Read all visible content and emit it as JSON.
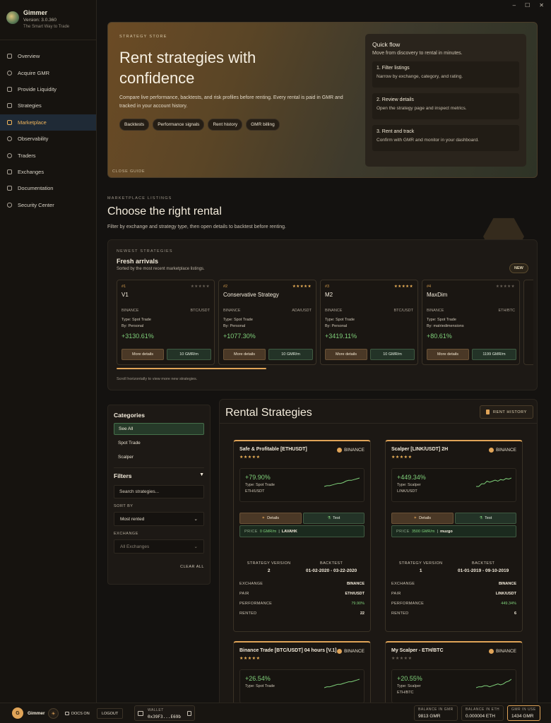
{
  "app": {
    "name": "Gimmer",
    "version": "Version: 3.0.360",
    "tagline": "The Smart Way to Trade"
  },
  "window": {
    "minimize": "–",
    "maximize": "☐",
    "close": "✕"
  },
  "sidebar": {
    "items": [
      {
        "label": "Overview",
        "icon": "grid-icon"
      },
      {
        "label": "Acquire GMR",
        "icon": "plus-circle-icon"
      },
      {
        "label": "Provide Liquidity",
        "icon": "card-icon"
      },
      {
        "label": "Strategies",
        "icon": "chart-icon"
      },
      {
        "label": "Marketplace",
        "icon": "cart-icon",
        "active": true
      },
      {
        "label": "Observability",
        "icon": "eye-icon"
      },
      {
        "label": "Traders",
        "icon": "users-icon"
      },
      {
        "label": "Exchanges",
        "icon": "exchange-icon"
      },
      {
        "label": "Documentation",
        "icon": "book-icon"
      },
      {
        "label": "Security Center",
        "icon": "shield-icon"
      }
    ]
  },
  "hero": {
    "eyebrow": "STRATEGY STORE",
    "title": "Rent strategies with confidence",
    "description": "Compare live performance, backtests, and risk profiles before renting. Every rental is paid in GMR and tracked in your account history.",
    "chips": [
      "Backtests",
      "Performance signals",
      "Rent history",
      "GMR billing"
    ],
    "close": "CLOSE GUIDE",
    "quick_flow": {
      "title": "Quick flow",
      "subtitle": "Move from discovery to rental in minutes.",
      "steps": [
        {
          "title": "1. Filter listings",
          "desc": "Narrow by exchange, category, and rating."
        },
        {
          "title": "2. Review details",
          "desc": "Open the strategy page and inspect metrics."
        },
        {
          "title": "3. Rent and track",
          "desc": "Confirm with GMR and monitor in your dashboard."
        }
      ]
    }
  },
  "marketplace": {
    "eyebrow": "MARKETPLACE LISTINGS",
    "title": "Choose the right rental",
    "description": "Filter by exchange and strategy type, then open details to backtest before renting."
  },
  "fresh": {
    "eyebrow": "NEWEST STRATEGIES",
    "title": "Fresh arrivals",
    "subtitle": "Sorted by the most recent marketplace listings.",
    "badge": "NEW",
    "hint": "Scroll horizontally to view more new strategies.",
    "scroll_position": 0.36,
    "cards": [
      {
        "num": "#1",
        "rating": 0,
        "name": "V1",
        "exchange": "BINANCE",
        "pair": "BTC/USDT",
        "type": "Type: Spot Trade",
        "by": "By: Personal",
        "pct": "+3130.61%",
        "details": "More details",
        "price": "10 GMR/m"
      },
      {
        "num": "#2",
        "rating": 5,
        "name": "Conservative Strategy",
        "exchange": "BINANCE",
        "pair": "ADA/USDT",
        "type": "Type: Spot Trade",
        "by": "By: Personal",
        "pct": "+1077.30%",
        "details": "More details",
        "price": "10 GMR/m"
      },
      {
        "num": "#3",
        "rating": 5,
        "name": "M2",
        "exchange": "BINANCE",
        "pair": "BTC/USDT",
        "type": "Type: Spot Trade",
        "by": "By: Personal",
        "pct": "+3419.11%",
        "details": "More details",
        "price": "10 GMR/m"
      },
      {
        "num": "#4",
        "rating": 0,
        "name": "MaxDim",
        "exchange": "BINANCE",
        "pair": "ETH/BTC",
        "type": "Type: Spot Trade",
        "by": "By: matriedimensions",
        "pct": "+80.61%",
        "details": "More details",
        "price": "1199 GMR/m"
      }
    ]
  },
  "filters": {
    "categories_title": "Categories",
    "categories": [
      "See All",
      "Spot Trade",
      "Scalper"
    ],
    "filters_title": "Filters",
    "search_placeholder": "Search strategies...",
    "sort_label": "SORT BY",
    "sort_value": "Most rented",
    "exchange_label": "EXCHANGE",
    "exchange_value": "All Exchanges",
    "clear": "CLEAR ALL"
  },
  "rental": {
    "title": "Rental Strategies",
    "history_button": "RENT HISTORY",
    "details_label": "Details",
    "test_label": "Test",
    "price_label": "PRICE",
    "version_label": "STRATEGY VERSION",
    "backtest_label": "BACKTEST",
    "kv_labels": [
      "EXCHANGE",
      "PAIR",
      "PERFORMANCE",
      "RENTED"
    ],
    "cards": [
      {
        "name": "Safe & Profitable [ETHUSDT]",
        "exchange": "BINANCE",
        "rating": 5,
        "pct": "+79.90%",
        "type": "Type: Spot Trade",
        "pair": "ETH/USDT",
        "price": "0 GMR/m",
        "owner": "LAVAHK",
        "version": "2",
        "backtest": "01-02-2020 - 03-22-2020",
        "kv": [
          "BINANCE",
          "ETH/USDT",
          "79.90%",
          "22"
        ],
        "spark": [
          4,
          5,
          5,
          6,
          7,
          8,
          8,
          9,
          11,
          12,
          12,
          13,
          14,
          15
        ]
      },
      {
        "name": "Scalper [LINK/USDT] 2H",
        "exchange": "BINANCE",
        "rating": 5,
        "pct": "+449.34%",
        "type": "Type: Scalper",
        "pair": "LINK/USDT",
        "price": "3500 GMR/m",
        "owner": "muzgo",
        "version": "1",
        "backtest": "01-01-2019 - 09-10-2019",
        "kv": [
          "BINANCE",
          "LINK/USDT",
          "449.34%",
          "6"
        ],
        "spark": [
          10,
          10,
          10.5,
          10.5,
          11,
          10.8,
          11,
          11.2,
          11,
          11.3,
          11.2,
          11.5,
          11.4,
          11.6
        ]
      },
      {
        "name": "Binance Trade [BTC/USDT] 04 hours [V.1]",
        "exchange": "BINANCE",
        "rating": 5,
        "pct": "+26.54%",
        "type": "Type: Spot Trade",
        "pair": "",
        "spark": [
          5,
          6,
          6,
          7,
          8,
          9,
          9,
          10,
          11,
          12,
          12,
          13,
          14,
          15
        ]
      },
      {
        "name": "My Scalper - ETH/BTC",
        "exchange": "BINANCE",
        "rating": 0,
        "pct": "+20.55%",
        "type": "Type: Scalper",
        "pair": "ETH/BTC",
        "spark": [
          5,
          6,
          6,
          7,
          7,
          6,
          7,
          8,
          9,
          8,
          9,
          11,
          12,
          14
        ]
      }
    ]
  },
  "footer": {
    "avatar": "G",
    "user": "Gimmer",
    "theme_icon": "☀",
    "docs": "DOCS ON",
    "logout": "LOGOUT",
    "wallet_label": "WALLET",
    "wallet_address": "0x39F3...E69b",
    "balances": [
      {
        "label": "BALANCE IN GMR",
        "value": "9813 GMR"
      },
      {
        "label": "BALANCE IN ETH",
        "value": "0.000004 ETH"
      },
      {
        "label": "GMR IN USE",
        "value": "1434 GMR",
        "highlight": true
      }
    ]
  },
  "colors": {
    "accent": "#e0a458",
    "positive": "#7fd07a",
    "star_on": "#f0b45a",
    "star_off": "#6a6258",
    "active_nav_bg": "#1f2a36"
  }
}
